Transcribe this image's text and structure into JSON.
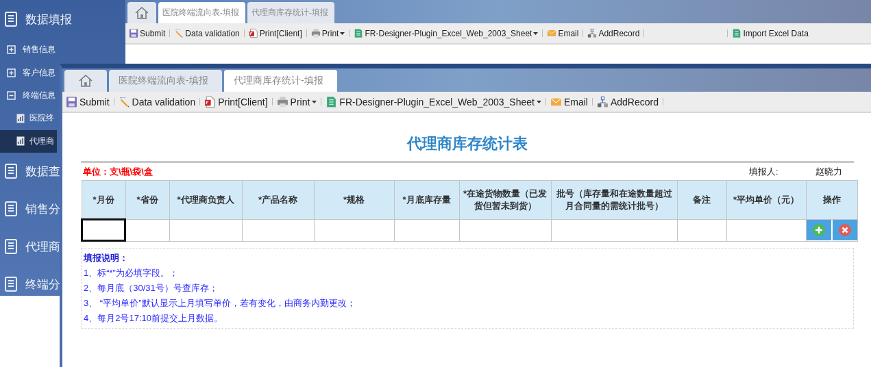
{
  "sidebar": {
    "items": [
      {
        "kind": "group",
        "label": "数据填报",
        "children": [
          {
            "kind": "category",
            "label": "销售信息",
            "expanded": false
          },
          {
            "kind": "category",
            "label": "客户信息",
            "expanded": false
          },
          {
            "kind": "category",
            "label": "终端信息",
            "expanded": true,
            "children": [
              {
                "kind": "report",
                "label": "医院终",
                "selected": false
              },
              {
                "kind": "report",
                "label": "代理商",
                "selected": true
              }
            ]
          }
        ]
      },
      {
        "kind": "group",
        "label": "数据查"
      },
      {
        "kind": "group",
        "label": "销售分"
      },
      {
        "kind": "group",
        "label": "代理商"
      },
      {
        "kind": "group",
        "label": "终端分"
      }
    ]
  },
  "back_window": {
    "tabs": [
      {
        "kind": "home",
        "selected": false
      },
      {
        "kind": "page",
        "label": "医院终端流向表-填报",
        "selected": true
      },
      {
        "kind": "page",
        "label": "代理商库存统计-填报",
        "selected": false
      }
    ],
    "toolbar": [
      {
        "kind": "save",
        "label": "Submit",
        "dropdown": false
      },
      {
        "kind": "validate",
        "label": "Data validation",
        "dropdown": false
      },
      {
        "kind": "pdf",
        "label": "Print[Client]",
        "dropdown": false
      },
      {
        "kind": "print",
        "label": "Print",
        "dropdown": true
      },
      {
        "kind": "excel",
        "label": "FR-Designer-Plugin_Excel_Web_2003_Sheet",
        "dropdown": true
      },
      {
        "kind": "email",
        "label": "Email",
        "dropdown": false
      },
      {
        "kind": "record",
        "label": "AddRecord",
        "dropdown": false
      }
    ],
    "toolbar_right": [
      {
        "kind": "excel",
        "label": "Import Excel Data",
        "dropdown": false
      }
    ]
  },
  "front_window": {
    "tabs": [
      {
        "kind": "home",
        "selected": false
      },
      {
        "kind": "page",
        "label": "医院终端流向表-填报",
        "selected": false
      },
      {
        "kind": "page",
        "label": "代理商库存统计-填报",
        "selected": true
      }
    ],
    "toolbar": [
      {
        "kind": "save",
        "label": "Submit",
        "dropdown": false
      },
      {
        "kind": "validate",
        "label": "Data validation",
        "dropdown": false
      },
      {
        "kind": "pdf",
        "label": "Print[Client]",
        "dropdown": false
      },
      {
        "kind": "print",
        "label": "Print",
        "dropdown": true
      },
      {
        "kind": "excel",
        "label": "FR-Designer-Plugin_Excel_Web_2003_Sheet",
        "dropdown": true
      },
      {
        "kind": "email",
        "label": "Email",
        "dropdown": false
      },
      {
        "kind": "record",
        "label": "AddRecord",
        "dropdown": false
      }
    ],
    "report": {
      "title": "代理商库存统计表",
      "unit": "单位：支\\瓶\\袋\\盒",
      "reporter_label": "填报人:",
      "reporter": "赵晓力",
      "table": {
        "columns": [
          "*月份",
          "*省份",
          "*代理商负责人",
          "*产品名称",
          "*规格",
          "*月底库存量",
          "*在途货物数量（已发货但暂未到货）",
          "批号（库存量和在途数量超过月合同量的需统计批号）",
          "备注",
          "*平均单价（元）",
          "操作"
        ],
        "rows": [
          {
            "cells": [
              {
                "selected": true
              },
              {
                "selected": false
              },
              {
                "selected": false
              },
              {
                "selected": false
              },
              {
                "selected": false
              },
              {
                "selected": false
              },
              {
                "selected": false
              },
              {
                "selected": false
              },
              {
                "selected": false
              },
              {
                "selected": false
              }
            ],
            "actions": [
              {
                "kind": "add"
              },
              {
                "kind": "delete"
              }
            ]
          }
        ]
      },
      "notes": {
        "title": "填报说明：",
        "lines": [
          "1、标“*”为必填字段。；",
          "2、每月底（30/31号）号查库存；",
          "3、 “平均单价”默认显示上月填写单价，若有变化，由商务内勤更改；",
          "4、每月2号17:10前提交上月数据。"
        ]
      }
    }
  }
}
